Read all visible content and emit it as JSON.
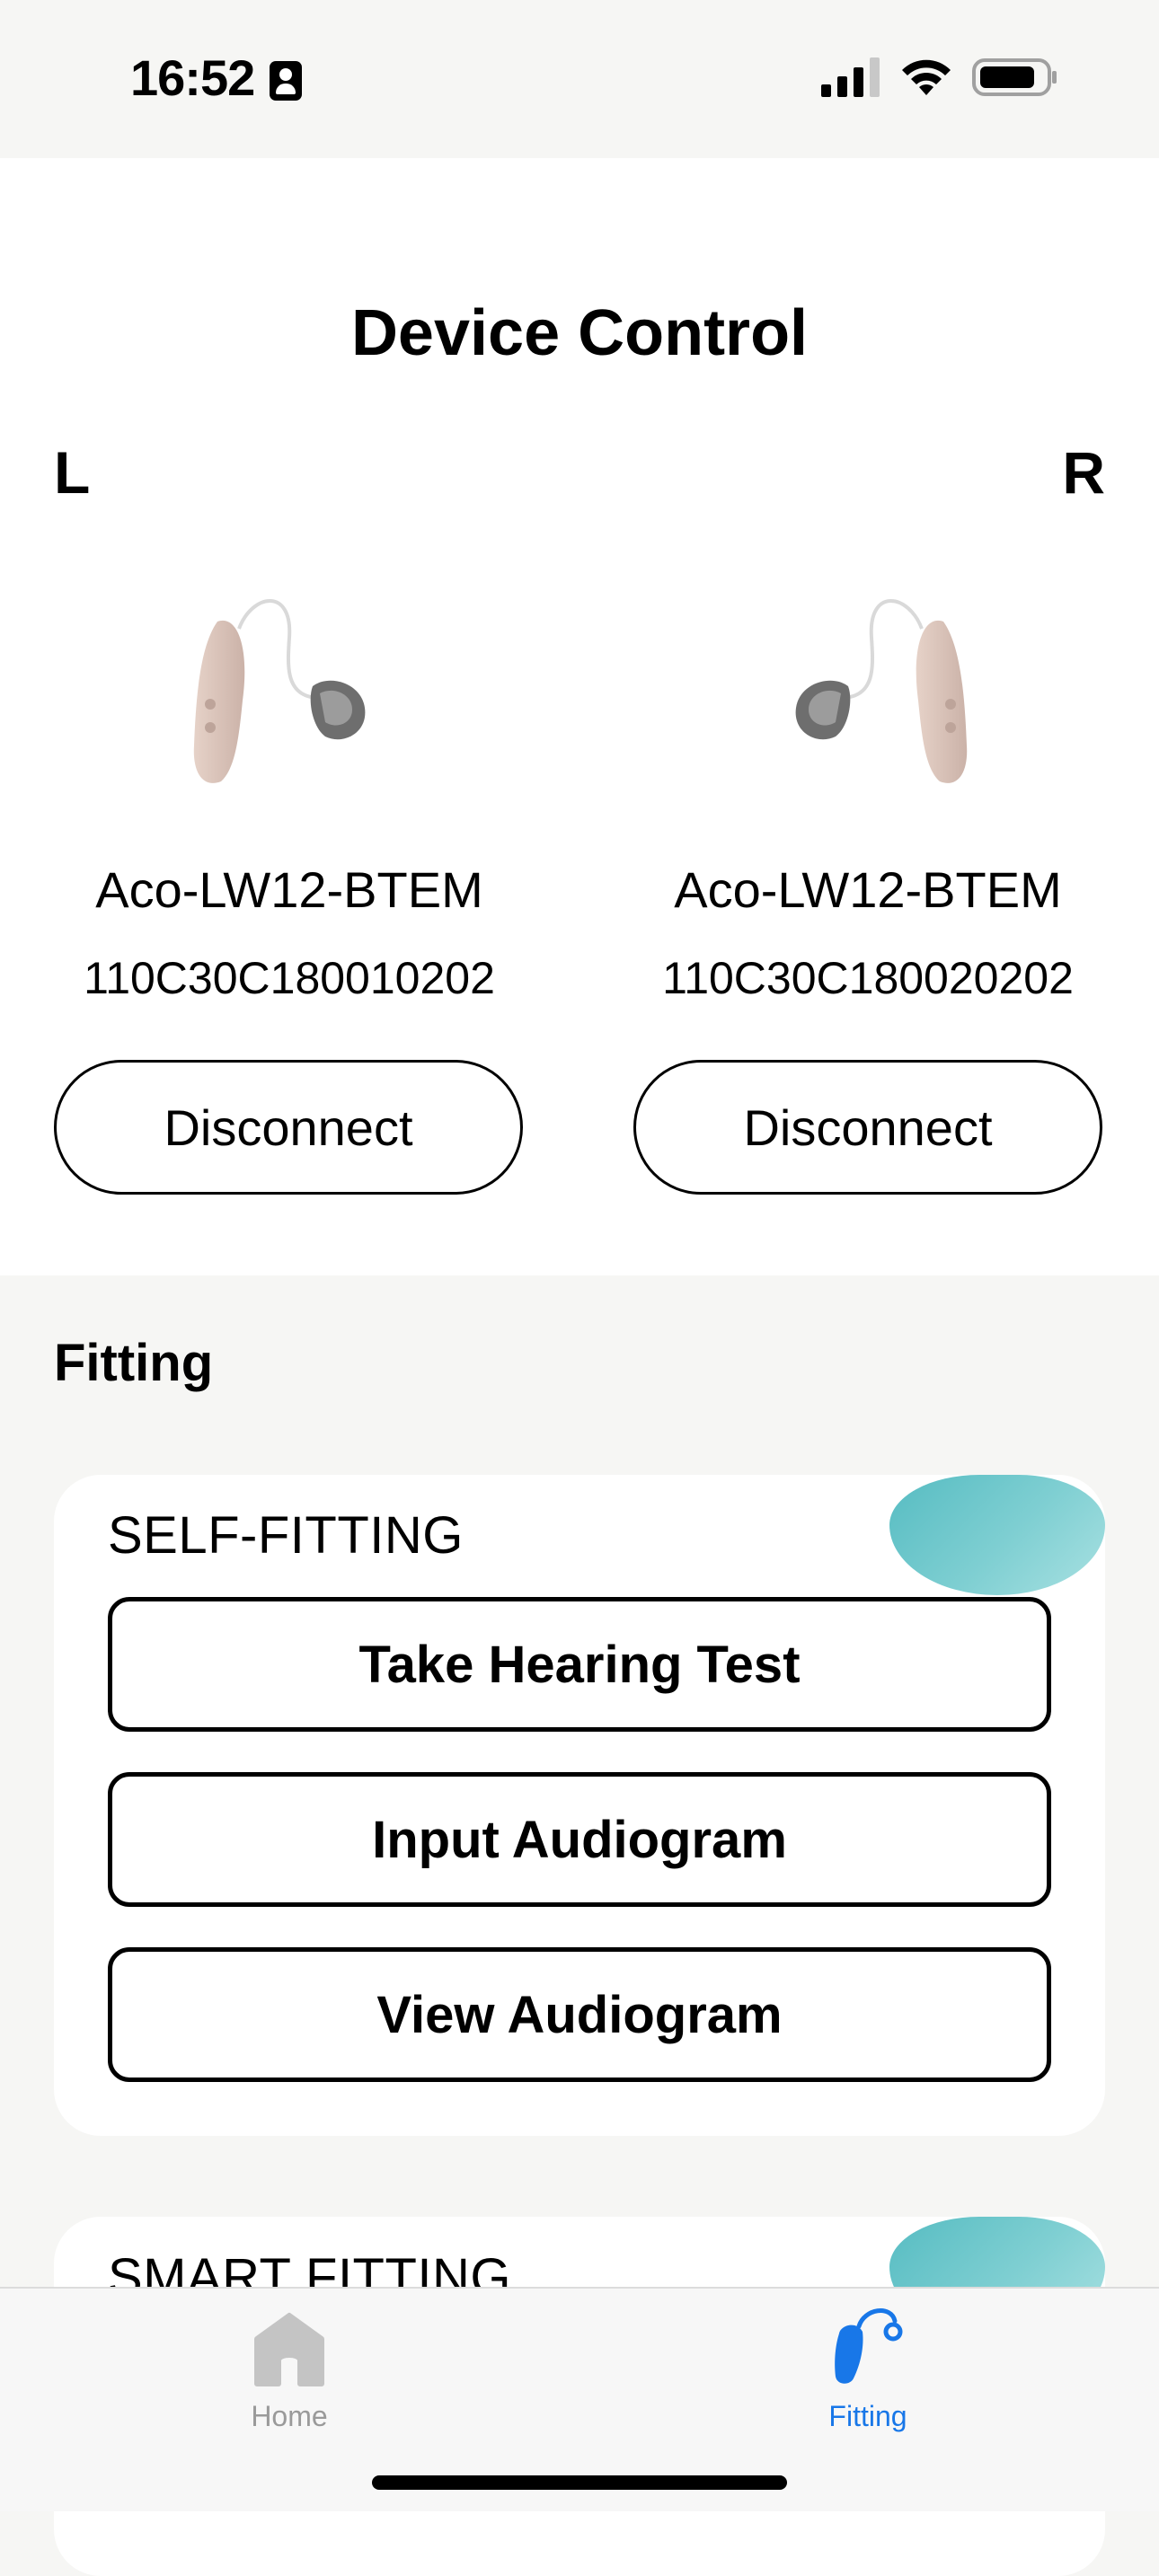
{
  "status_bar": {
    "time": "16:52",
    "icons": [
      "contact-card-icon",
      "cellular-signal-icon",
      "wifi-icon",
      "battery-icon"
    ]
  },
  "header": {
    "title": "Device Control"
  },
  "devices": {
    "left": {
      "side_label": "L",
      "model": "Aco-LW12-BTEM",
      "serial": "110C30C180010202",
      "button_label": "Disconnect"
    },
    "right": {
      "side_label": "R",
      "model": "Aco-LW12-BTEM",
      "serial": "110C30C180020202",
      "button_label": "Disconnect"
    }
  },
  "fitting": {
    "section_title": "Fitting",
    "self_fitting": {
      "label": "SELF-FITTING",
      "buttons": [
        "Take Hearing Test",
        "Input Audiogram",
        "View Audiogram"
      ]
    },
    "smart_fitting": {
      "label": "SMART FITTING"
    }
  },
  "tab_bar": {
    "tabs": [
      {
        "label": "Home",
        "icon": "home-icon",
        "active": false
      },
      {
        "label": "Fitting",
        "icon": "hearing-aid-icon",
        "active": true
      }
    ]
  },
  "colors": {
    "accent": "#1877e8",
    "inactive_tab": "#9a9a9a",
    "card_blob": "#7fcfd2",
    "background": "#f6f6f4"
  }
}
